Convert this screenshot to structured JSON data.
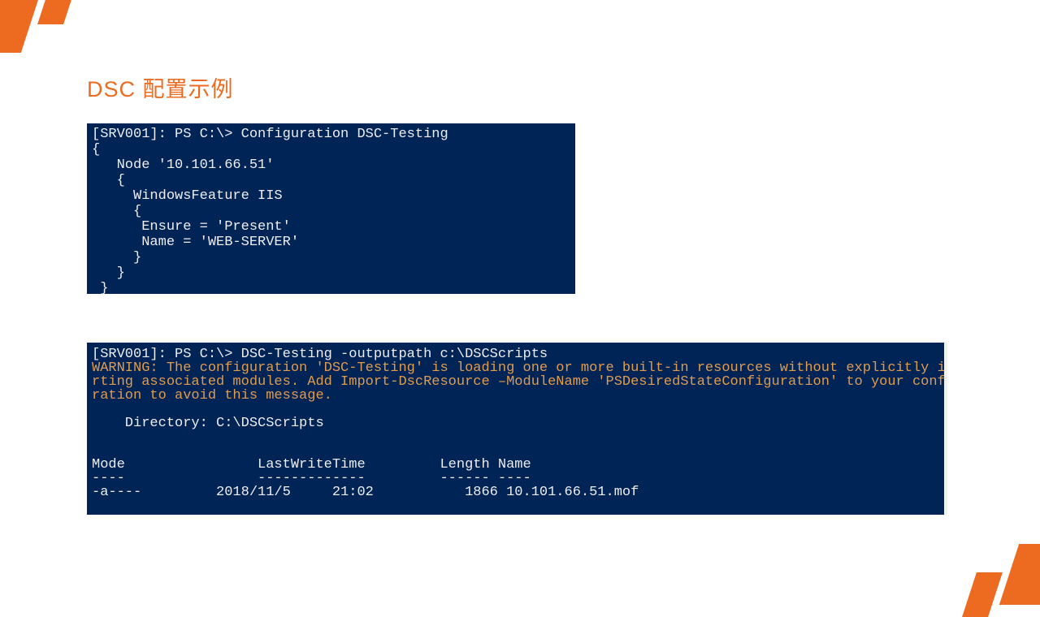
{
  "title": "DSC 配置示例",
  "terminal1": {
    "content": "[SRV001]: PS C:\\> Configuration DSC-Testing\n{\n   Node '10.101.66.51'\n   {\n     WindowsFeature IIS\n     {\n      Ensure = 'Present'\n      Name = 'WEB-SERVER'\n     }\n   }\n }"
  },
  "terminal2": {
    "line1": "[SRV001]: PS C:\\> DSC-Testing -outputpath c:\\DSCScripts",
    "warning": "WARNING: The configuration 'DSC-Testing' is loading one or more built-in resources without explicitly impo\nrting associated modules. Add Import-DscResource –ModuleName 'PSDesiredStateConfiguration' to your configu\nration to avoid this message.",
    "rest": "\n\n    Directory: C:\\DSCScripts\n\n\nMode                LastWriteTime         Length Name\n----                -------------         ------ ----\n-a----         2018/11/5     21:02           1866 10.101.66.51.mof"
  }
}
